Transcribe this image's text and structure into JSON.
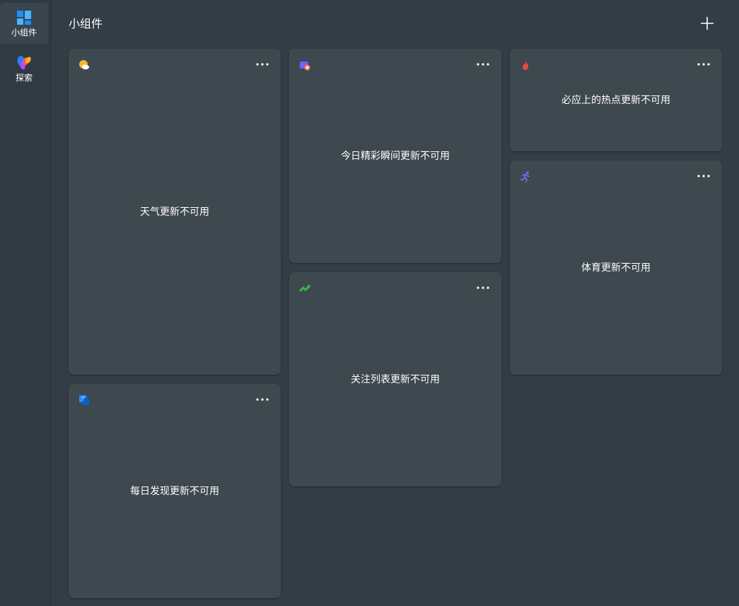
{
  "sidebar": {
    "items": [
      {
        "label": "小组件",
        "icon": "widgets-icon",
        "active": true
      },
      {
        "label": "探索",
        "icon": "explore-icon",
        "active": false
      }
    ]
  },
  "header": {
    "title": "小组件",
    "add_icon": "plus-icon"
  },
  "widgets": {
    "weather": {
      "icon": "weather-icon",
      "icon_color": "#f7b731",
      "status": "天气更新不可用"
    },
    "discover": {
      "icon": "discover-icon",
      "icon_color": "#1e90ff",
      "status": "每日发现更新不可用"
    },
    "moments": {
      "icon": "photo-icon",
      "icon_color": "#7b5cff",
      "status": "今日精彩瞬间更新不可用"
    },
    "watchlist": {
      "icon": "stocks-icon",
      "icon_color": "#3cb34a",
      "status": "关注列表更新不可用"
    },
    "trending": {
      "icon": "trending-icon",
      "icon_color": "#e04848",
      "status": "必应上的热点更新不可用"
    },
    "sports": {
      "icon": "sports-icon",
      "icon_color": "#7b6cff",
      "status": "体育更新不可用"
    }
  },
  "theme": {
    "background": "#323d45",
    "card": "#3e484f",
    "text": "#ffffff"
  }
}
